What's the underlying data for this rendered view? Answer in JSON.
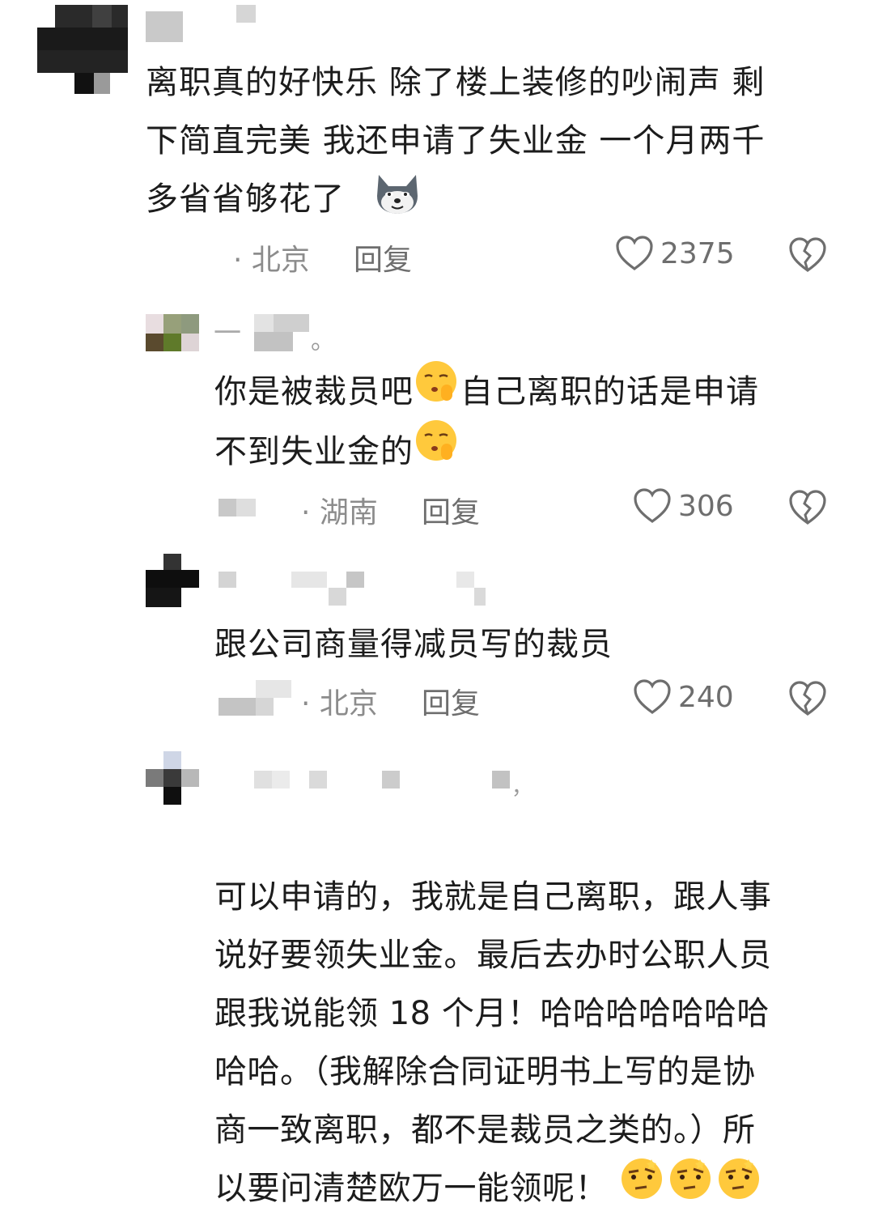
{
  "comments": [
    {
      "text": "离职真的好快乐 除了楼上装修的吵闹声 剩\n下简直完美 我还申请了失业金 一个月两千\n多省省够花了",
      "location": "· 北京",
      "reply": "回复",
      "likes": "2375",
      "emoji": "dog-face-emoji"
    },
    {
      "text_part1": "你是被裁员吧",
      "text_part2": "自己离职的话是申请",
      "text_line2": "不到失业金的",
      "location": "· 湖南",
      "reply": "回复",
      "likes": "306",
      "emoji": "shushing-face-emoji"
    },
    {
      "text": "跟公司商量得减员写的裁员",
      "location": "· 北京",
      "reply": "回复",
      "likes": "240"
    },
    {
      "text": "可以申请的，我就是自己离职，跟人事\n说好要领失业金。最后去办时公职人员\n跟我说能领 18 个月！哈哈哈哈哈哈哈\n哈哈。（我解除合同证明书上写的是协\n商一致离职，都不是裁员之类的。）所\n以要问清楚欧万一能领呢！",
      "emoji": "thinking-face-emoji"
    }
  ],
  "usernames": {
    "c2_suffix": "一",
    "c2_end": "。",
    "c4_end": "，"
  },
  "colors": {
    "text": "#1c1c1c",
    "meta": "#8c8c8c",
    "icon": "#6e6e6e"
  }
}
